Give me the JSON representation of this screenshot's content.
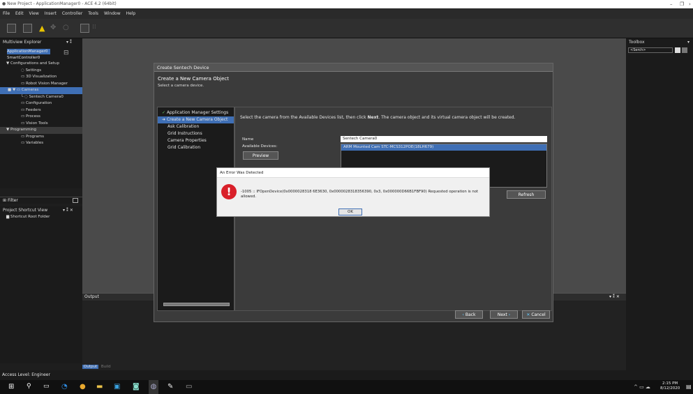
{
  "window": {
    "title": "New Project - ApplicationManager0 - ACE 4.2 (64bit)"
  },
  "menu": [
    "File",
    "Edit",
    "View",
    "Insert",
    "Controller",
    "Tools",
    "Window",
    "Help"
  ],
  "explorer": {
    "title": "Multiview Explorer",
    "controller_a": "ApplicationManager0",
    "controller_b": "SmartController0",
    "items": [
      {
        "label": "Configurations and Setup",
        "level": 0
      },
      {
        "label": "Settings",
        "level": 2
      },
      {
        "label": "3D Visualization",
        "level": 2
      },
      {
        "label": "Robot Vision Manager",
        "level": 2
      },
      {
        "label": "Cameras",
        "level": 1
      },
      {
        "label": "Sentech Camera0",
        "level": 3
      },
      {
        "label": "Configuration",
        "level": 2
      },
      {
        "label": "Feeders",
        "level": 2
      },
      {
        "label": "Process",
        "level": 2
      },
      {
        "label": "Vision Tools",
        "level": 2
      },
      {
        "label": "Programming",
        "level": 0
      },
      {
        "label": "Programs",
        "level": 2
      },
      {
        "label": "Variables",
        "level": 2
      }
    ]
  },
  "filter": {
    "label": "Filter"
  },
  "shortcut_view": {
    "title": "Project Shortcut View",
    "root": "Shortcut Root Folder"
  },
  "toolbox": {
    "title": "Toolbox",
    "search_placeholder": "<Serch>"
  },
  "output": {
    "title": "Output",
    "tabs": [
      "Output",
      "Build"
    ]
  },
  "dialog": {
    "title": "Create Sentech Device",
    "heading": "Create a New Camera Object",
    "subheading": "Select a camera device.",
    "steps": [
      "Application Manager Settings",
      "Create a New Camera Object",
      "Ask Calibration",
      "Grid Instructions",
      "Camera Properties",
      "Grid Calibration"
    ],
    "instruction_pre": "Select the camera from the Available Devices list, then click ",
    "instruction_bold": "Next",
    "instruction_post": ".  The camera object and its virtual camera object will be created.",
    "name_label": "Name",
    "name_value": "Sentech Camera0",
    "devices_label": "Available Devices:",
    "devices": [
      "ARM Mounted Cam STC-MCS312POE(18LH679)"
    ],
    "preview_button": "Preview",
    "refresh_button": "Refresh",
    "back_button": "Back",
    "next_button": "Next",
    "cancel_button": "Cancel"
  },
  "error": {
    "title": "An Error Was Detected",
    "message": "-1005 :: IFOpenDevice(0x0000028318 6E3630, 0x0000028318356390, 0x3, 0x000000D66B1FBF90) Requested operation is not allowed.",
    "ok": "OK"
  },
  "status": {
    "access_level": "Access Level: Engineer"
  },
  "tray": {
    "time": "2:15 PM",
    "date": "8/12/2020"
  }
}
